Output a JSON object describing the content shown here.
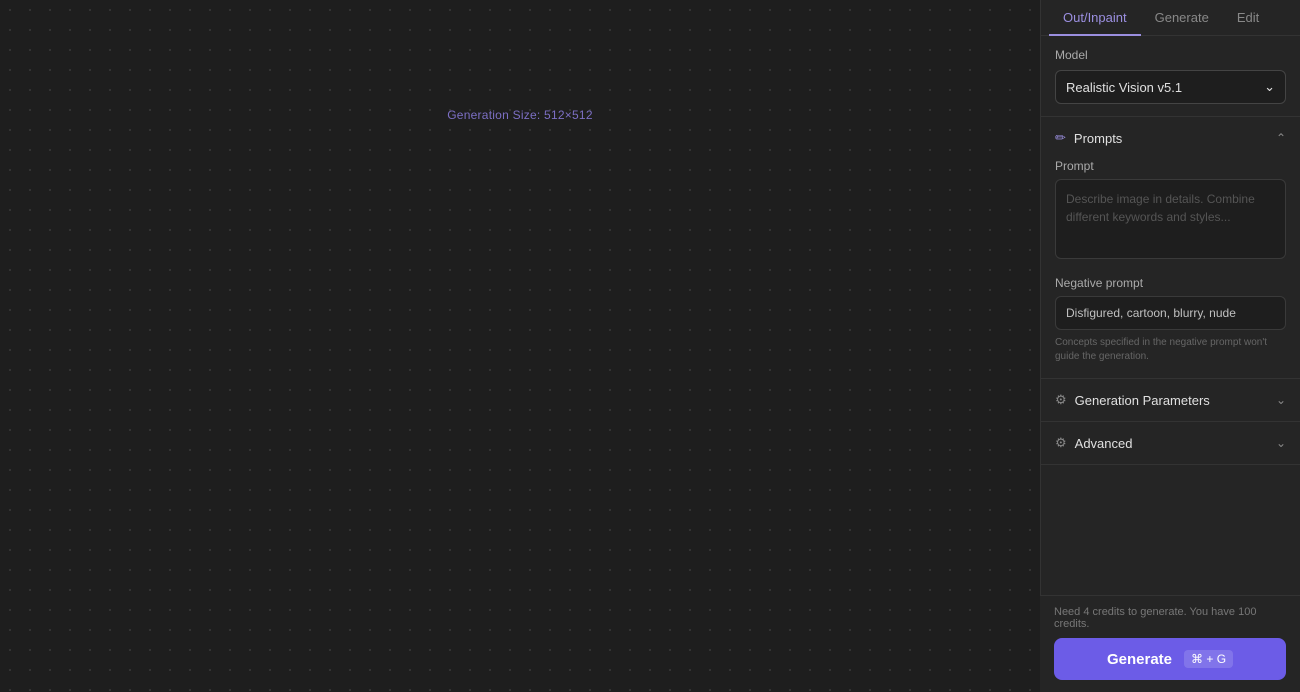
{
  "canvas": {
    "generation_size_label": "Generation Size: 512×512"
  },
  "tabs": [
    {
      "id": "out-inpaint",
      "label": "Out/Inpaint",
      "active": true
    },
    {
      "id": "generate",
      "label": "Generate",
      "active": false
    },
    {
      "id": "edit",
      "label": "Edit",
      "active": false
    }
  ],
  "model_section": {
    "label": "Model",
    "selected": "Realistic Vision v5.1"
  },
  "prompts_section": {
    "title": "Prompts",
    "expanded": true,
    "prompt_field": {
      "label": "Prompt",
      "placeholder": "Describe image in details. Combine different keywords and styles...",
      "value": ""
    },
    "negative_prompt_field": {
      "label": "Negative prompt",
      "value": "Disfigured, cartoon, blurry, nude",
      "hint": "Concepts specified in the negative prompt won't guide the generation."
    }
  },
  "generation_params_section": {
    "title": "Generation Parameters",
    "expanded": false
  },
  "advanced_section": {
    "title": "Advanced",
    "expanded": false
  },
  "footer": {
    "credits_text": "Need 4 credits to generate. You have 100 credits.",
    "generate_button_label": "Generate",
    "shortcut": "⌘ + G"
  }
}
